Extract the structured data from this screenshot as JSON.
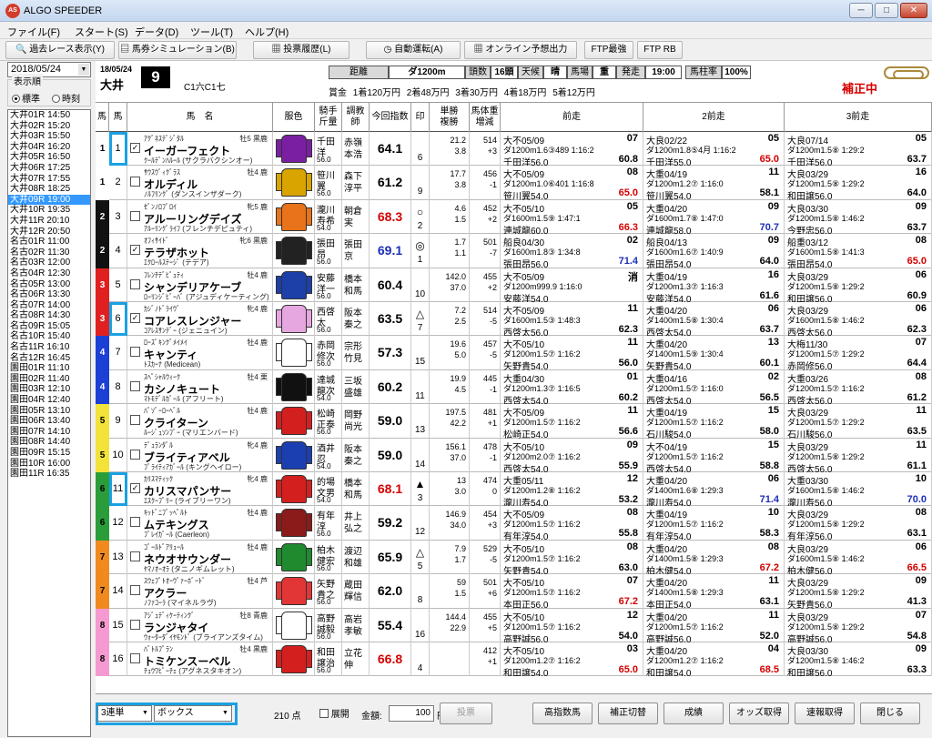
{
  "app": {
    "title": "ALGO SPEEDER",
    "icon_text": "AS"
  },
  "window": {
    "minimize": "─",
    "maximize": "□",
    "close": "✕"
  },
  "menu": [
    "ファイル(F)",
    "スタート(S)",
    "データ(D)",
    "ツール(T)",
    "ヘルプ(H)"
  ],
  "toolbar": [
    {
      "icon": "magnifier-icon",
      "label": "過去レース表示(Y)"
    },
    {
      "icon": "ticket-icon",
      "label": "馬券シミュレーション(B)"
    },
    {
      "icon": "document-icon",
      "label": "投票履歴(L)"
    },
    {
      "icon": "clock-icon",
      "label": "自動運転(A)"
    },
    {
      "icon": "document-icon",
      "label": "オンライン予想出力"
    },
    {
      "icon": "",
      "label": "FTP最強"
    },
    {
      "icon": "",
      "label": "FTP RB"
    }
  ],
  "sidebar": {
    "date": "2018/05/24",
    "display_order_label": "表示順",
    "radio": [
      {
        "label": "標準",
        "selected": true
      },
      {
        "label": "時刻",
        "selected": false
      }
    ],
    "races": [
      "大井01R 14:50",
      "大井02R 15:20",
      "大井03R 15:50",
      "大井04R 16:20",
      "大井05R 16:50",
      "大井06R 17:25",
      "大井07R 17:55",
      "大井08R 18:25",
      "大井09R 19:00",
      "大井10R 19:35",
      "大井11R 20:10",
      "大井12R 20:50",
      "名古01R 11:00",
      "名古02R 11:30",
      "名古03R 12:00",
      "名古04R 12:30",
      "名古05R 13:00",
      "名古06R 13:30",
      "名古07R 14:00",
      "名古08R 14:30",
      "名古09R 15:05",
      "名古10R 15:40",
      "名古11R 16:10",
      "名古12R 16:45",
      "園田01R 11:10",
      "園田02R 11:40",
      "園田03R 12:10",
      "園田04R 12:40",
      "園田05R 13:10",
      "園田06R 13:40",
      "園田07R 14:10",
      "園田08R 14:40",
      "園田09R 15:15",
      "園田10R 16:00",
      "園田11R 16:35"
    ],
    "selected_index": 8
  },
  "race": {
    "date": "18/05/24",
    "track": "大井",
    "race_no": "9",
    "class": "C1六C1七",
    "distance_label": "距離",
    "distance": "ダ1200m",
    "runners_label": "頭数",
    "runners": "16頭",
    "weather_label": "天候",
    "weather": "晴",
    "going_label": "馬場",
    "going": "重",
    "post_label": "発走",
    "post_time": "19:00",
    "pillar_label": "馬柱率",
    "pillar_rate": "100%",
    "prize": "賞金 1着120万円 2着48万円 3着30万円 4着18万円 5着12万円",
    "corrected": "補正中"
  },
  "columns": [
    "馬",
    "馬",
    "馬　名",
    "服色",
    "騎手\n斤量",
    "調教\n師",
    "今回指数",
    "印",
    "単勝\n複勝",
    "馬体重\n増減",
    "前走",
    "2前走",
    "3前走"
  ],
  "horses": [
    {
      "frame": "1",
      "num": "1",
      "checked": true,
      "hl": true,
      "sire": "ｱｸﾞﾈｽﾃﾞｼﾞﾀﾙ",
      "sex": "牡5 黒鹿",
      "name": "イーガーフェクト",
      "dam": "ｸｰﾙﾃﾞﾝﾊﾙｰﾙ (サクラバクシンオー)",
      "silk": "#7a1fa2",
      "j1": "千田",
      "j2": "洋",
      "w": "56.0",
      "t1": "赤嶺",
      "t2": "本浩",
      "idx": "64.1",
      "idxc": "#000",
      "m1": "",
      "m2": "6",
      "o1": "21.2",
      "o2": "3.8",
      "o3": "514",
      "o4": "+3",
      "p1a": "大不05/09",
      "p1b": "ダ1200m1.6③489 1:16:2",
      "p1c": "千田洋56.0",
      "p1pos": "07",
      "p1idx": "60.8",
      "p2a": "大良02/22",
      "p2b": "ダ1200m1.8⑤4月 1:16:2",
      "p2c": "千田洋55.0",
      "p2pos": "05",
      "p2idx": "65.0",
      "p3a": "大良07/14",
      "p3b": "ダ1200m1.5⑧ 1:29:2",
      "p3c": "千田洋56.0",
      "p3pos": "05",
      "p3idx": "63.7"
    },
    {
      "frame": "1",
      "num": "2",
      "checked": false,
      "hl": false,
      "sire": "ｻｳｽｳﾞｨｸﾞﾗｽ",
      "sex": "牡4 鹿",
      "name": "オルディル",
      "dam": "ﾉﾙﾌﾘﾝｸﾞ (ダンスインザダーク)",
      "silk": "#d9a400",
      "j1": "笹川",
      "j2": "翼",
      "w": "56.0",
      "t1": "森下",
      "t2": "淳平",
      "idx": "61.2",
      "idxc": "#000",
      "m1": "",
      "m2": "9",
      "o1": "17.7",
      "o2": "3.8",
      "o3": "456",
      "o4": "-1",
      "p1a": "大不05/09",
      "p1b": "ダ1200m1.0⑥401 1:16:8",
      "p1c": "笹川翼54.0",
      "p1pos": "08",
      "p1idx": "65.0",
      "p2a": "大重04/19",
      "p2b": "ダ1200m1.2⑦ 1:16:0",
      "p2c": "笹川翼54.0",
      "p2pos": "11",
      "p2idx": "58.1",
      "p3a": "大良03/29",
      "p3b": "ダ1200m1.5⑧ 1:29:2",
      "p3c": "和田譲56.0",
      "p3pos": "16",
      "p3idx": "64.0"
    },
    {
      "frame": "2",
      "num": "3",
      "checked": false,
      "hl": false,
      "sire": "ｾﾞﾝﾉﾛﾌﾞﾛｲ",
      "sex": "牝5 鹿",
      "name": "アルーリングデイズ",
      "dam": "ｱﾙｰﾘﾝｸﾞﾗｲﾌ (フレンチデピュティ)",
      "silk": "#e8731a",
      "j1": "瀧川",
      "j2": "寿希",
      "w": "54.0",
      "t1": "朝倉",
      "t2": "実",
      "idx": "68.3",
      "idxc": "#d40000",
      "m1": "○",
      "m2": "2",
      "o1": "4.6",
      "o2": "1.5",
      "o3": "452",
      "o4": "+2",
      "p1a": "大不05/10",
      "p1b": "ダ1600m1.5⑨ 1:47:1",
      "p1c": "連城龍60.0",
      "p1pos": "05",
      "p1idx": "66.3",
      "p2a": "大重04/20",
      "p2b": "ダ1600m1.7⑧ 1:47:0",
      "p2c": "連城龍58.0",
      "p2pos": "09",
      "p2idx": "70.7",
      "p3a": "大良03/30",
      "p3b": "ダ1200m1.5⑧ 1:46:2",
      "p3c": "今野忠56.0",
      "p3pos": "09",
      "p3idx": "63.7"
    },
    {
      "frame": "2",
      "num": "4",
      "checked": true,
      "hl": false,
      "sire": "ｵﾌｨｻｲﾄﾞ",
      "sex": "牝6 黒鹿",
      "name": "テラザホット",
      "dam": "ｴｸﾛｰﾙｽﾃｰｼﾞ (テデア)",
      "silk": "#222",
      "j1": "張田",
      "j2": "昂",
      "w": "56.0",
      "t1": "張田",
      "t2": "京",
      "idx": "69.1",
      "idxc": "#1c2fb8",
      "m1": "◎",
      "m2": "1",
      "o1": "1.7",
      "o2": "1.1",
      "o3": "501",
      "o4": "-7",
      "p1a": "船良04/30",
      "p1b": "ダ1600m1.8③ 1:34:8",
      "p1c": "張田昂56.0",
      "p1pos": "02",
      "p1idx": "71.4",
      "p2a": "船良04/13",
      "p2b": "ダ1600m1.6⑦ 1:40:9",
      "p2c": "張田昂54.0",
      "p2pos": "09",
      "p2idx": "64.0",
      "p3a": "船重03/12",
      "p3b": "ダ1600m1.5⑧ 1:41:3",
      "p3c": "張田昂54.0",
      "p3pos": "08",
      "p3idx": "65.0"
    },
    {
      "frame": "3",
      "num": "5",
      "checked": false,
      "hl": false,
      "sire": "ﾌﾚﾝﾁﾃﾞﾋﾟｭﾃｨ",
      "sex": "牡4 鹿",
      "name": "シャンデリアケーブ",
      "dam": "ﾛｰﾘﾝｼﾞﾋﾞｰﾊﾞ (アジュディケーティング)",
      "silk": "#1c3fa8",
      "j1": "安藤",
      "j2": "洋一",
      "w": "56.0",
      "t1": "橋本",
      "t2": "和馬",
      "idx": "60.4",
      "idxc": "#000",
      "m1": "",
      "m2": "10",
      "o1": "142.0",
      "o2": "37.0",
      "o3": "455",
      "o4": "+2",
      "p1a": "大不05/09",
      "p1b": "ダ1200m999.9 1:16:0",
      "p1c": "安藤洋54.0",
      "p1pos": "消",
      "p1idx": "",
      "p2a": "大重04/19",
      "p2b": "ダ1200m1.3⑦ 1:16:3",
      "p2c": "安藤洋54.0",
      "p2pos": "16",
      "p2idx": "61.6",
      "p3a": "大良03/29",
      "p3b": "ダ1200m1.5⑧ 1:29:2",
      "p3c": "和田譲56.0",
      "p3pos": "06",
      "p3idx": "60.9"
    },
    {
      "frame": "3",
      "num": "6",
      "checked": true,
      "hl": true,
      "sire": "ｶｼﾞﾉﾄﾞﾗｲｳﾞ",
      "sex": "牝4 鹿",
      "name": "コアレスレンジャー",
      "dam": "ｺｱﾚｽｻﾝﾃﾞｰ (ジェニュイン)",
      "silk": "#e6a6e0",
      "j1": "西啓",
      "j2": "太",
      "w": "56.0",
      "t1": "阪本",
      "t2": "秦之",
      "idx": "63.5",
      "idxc": "#000",
      "m1": "△",
      "m2": "7",
      "o1": "7.2",
      "o2": "2.5",
      "o3": "514",
      "o4": "-5",
      "p1a": "大不05/09",
      "p1b": "ダ1600m1.5③ 1:48:3",
      "p1c": "西啓太56.0",
      "p1pos": "11",
      "p1idx": "62.3",
      "p2a": "大重04/20",
      "p2b": "ダ1400m1.5⑧ 1:30:4",
      "p2c": "西啓太54.0",
      "p2pos": "06",
      "p2idx": "63.7",
      "p3a": "大良03/29",
      "p3b": "ダ1600m1.5⑧ 1:46:2",
      "p3c": "西啓太56.0",
      "p3pos": "06",
      "p3idx": "62.3"
    },
    {
      "frame": "4",
      "num": "7",
      "checked": false,
      "hl": false,
      "sire": "ﾛｰｽﾞｷﾝｸﾞﾒｲﾒｲ",
      "sex": "牡4 鹿",
      "name": "キャンティ",
      "dam": "ﾄｽｶｰﾅ (Medicean)",
      "silk": "#fff",
      "j1": "赤岡",
      "j2": "修次",
      "w": "56.0",
      "t1": "宗形",
      "t2": "竹見",
      "idx": "57.3",
      "idxc": "#000",
      "m1": "",
      "m2": "15",
      "o1": "19.6",
      "o2": "5.0",
      "o3": "457",
      "o4": "-5",
      "p1a": "大不05/10",
      "p1b": "ダ1200m1.5⑦ 1:16:2",
      "p1c": "矢野貴54.0",
      "p1pos": "11",
      "p1idx": "56.0",
      "p2a": "大重04/20",
      "p2b": "ダ1400m1.5⑨ 1:30:4",
      "p2c": "矢野貴54.0",
      "p2pos": "13",
      "p2idx": "60.1",
      "p3a": "大梅11/30",
      "p3b": "ダ1200m1.5⑦ 1:29:2",
      "p3c": "赤岡修56.0",
      "p3pos": "07",
      "p3idx": "64.4"
    },
    {
      "frame": "4",
      "num": "8",
      "checked": false,
      "hl": false,
      "sire": "ｽﾍﾟｼｬﾙｳｨｰｸ",
      "sex": "牡4 栗",
      "name": "カシノキュート",
      "dam": "ﾏﾄﾓﾃﾞﾙｶﾞｰﾙ (アフリート)",
      "silk": "#111",
      "j1": "達城",
      "j2": "龍次",
      "w": "54.0",
      "t1": "三坂",
      "t2": "盛雄",
      "idx": "60.2",
      "idxc": "#000",
      "m1": "",
      "m2": "11",
      "o1": "19.9",
      "o2": "4.5",
      "o3": "445",
      "o4": "-1",
      "p1a": "大重04/30",
      "p1b": "ダ1200m1.3⑦ 1:16:5",
      "p1c": "西啓太54.0",
      "p1pos": "01",
      "p1idx": "60.2",
      "p2a": "大重04/16",
      "p2b": "ダ1200m1.5⑦ 1:16:0",
      "p2c": "西啓太54.0",
      "p2pos": "02",
      "p2idx": "56.5",
      "p3a": "大重03/26",
      "p3b": "ダ1200m1.5⑦ 1:16:2",
      "p3c": "西啓太56.0",
      "p3pos": "08",
      "p3idx": "61.2"
    },
    {
      "frame": "5",
      "num": "9",
      "checked": false,
      "hl": false,
      "sire": "ﾊﾟｿﾞｰﾛｰﾍﾞﾙ",
      "sex": "牡4 鹿",
      "name": "クライターン",
      "dam": "ﾙｰｼﾞｭｿﾝﾌﾞｰ (マリエンバード)",
      "silk": "#d41f1f",
      "j1": "松崎",
      "j2": "正泰",
      "w": "56.0",
      "t1": "岡野",
      "t2": "尚光",
      "idx": "59.0",
      "idxc": "#000",
      "m1": "",
      "m2": "13",
      "o1": "197.5",
      "o2": "42.2",
      "o3": "481",
      "o4": "+1",
      "p1a": "大不05/09",
      "p1b": "ダ1200m1.5⑦ 1:16:2",
      "p1c": "松崎正54.0",
      "p1pos": "11",
      "p1idx": "56.6",
      "p2a": "大重04/19",
      "p2b": "ダ1200m1.5⑦ 1:16:2",
      "p2c": "石川駿54.0",
      "p2pos": "15",
      "p2idx": "58.0",
      "p3a": "大良03/29",
      "p3b": "ダ1200m1.5⑦ 1:29:2",
      "p3c": "石川駿56.0",
      "p3pos": "11",
      "p3idx": "63.5"
    },
    {
      "frame": "5",
      "num": "10",
      "checked": false,
      "hl": false,
      "sire": "ﾃﾞｭﾗﾝﾀﾞﾙ",
      "sex": "牝4 鹿",
      "name": "ブライティアベル",
      "dam": "ﾌﾞﾗｲﾃｨｱｶﾞｰﾙ (キングヘイロー)",
      "silk": "#1b3fb0",
      "j1": "酒井",
      "j2": "忍",
      "w": "54.0",
      "t1": "阪本",
      "t2": "秦之",
      "idx": "59.0",
      "idxc": "#000",
      "m1": "",
      "m2": "14",
      "o1": "156.1",
      "o2": "37.0",
      "o3": "478",
      "o4": "-1",
      "p1a": "大不05/10",
      "p1b": "ダ1200m2.0⑦ 1:16:2",
      "p1c": "西啓太54.0",
      "p1pos": "09",
      "p1idx": "55.9",
      "p2a": "大不04/19",
      "p2b": "ダ1200m1.5⑦ 1:16:2",
      "p2c": "西啓太54.0",
      "p2pos": "15",
      "p2idx": "58.8",
      "p3a": "大良03/29",
      "p3b": "ダ1200m1.5⑧ 1:29:2",
      "p3c": "西啓太56.0",
      "p3pos": "11",
      "p3idx": "61.1"
    },
    {
      "frame": "6",
      "num": "11",
      "checked": true,
      "hl": true,
      "sire": "ｶﾘｽﾏﾃｨｯｸ",
      "sex": "牝4 鹿",
      "name": "カリスマパンサー",
      "dam": "ｴｽｸｰﾌﾟﾘｰ (ライブリーワン)",
      "silk": "#d41f1f",
      "j1": "的場",
      "j2": "文男",
      "w": "54.0",
      "t1": "橋本",
      "t2": "和馬",
      "idx": "68.1",
      "idxc": "#d40000",
      "m1": "▲",
      "m2": "3",
      "o1": "13",
      "o2": "3.0",
      "o3": "474",
      "o4": "0",
      "p1a": "大重05/11",
      "p1b": "ダ1200m1.2⑧ 1:16:2",
      "p1c": "瀧川寿54.0",
      "p1pos": "12",
      "p1idx": "53.2",
      "p2a": "大重04/20",
      "p2b": "ダ1400m1.6⑧ 1:29:3",
      "p2c": "瀧川寿54.0",
      "p2pos": "06",
      "p2idx": "71.4",
      "p3a": "大重03/30",
      "p3b": "ダ1600m1.5⑧ 1:46:2",
      "p3c": "瀧川寿56.0",
      "p3pos": "10",
      "p3idx": "70.0"
    },
    {
      "frame": "6",
      "num": "12",
      "checked": false,
      "hl": false,
      "sire": "ｷｯﾄﾞﾆﾌﾞｯﾍﾟﾙﾄ",
      "sex": "牡4 鹿",
      "name": "ムテキングス",
      "dam": "ﾌﾞﾚｲｶﾞｰﾙ (Caerleon)",
      "silk": "#8b1a1a",
      "j1": "有年",
      "j2": "淳",
      "w": "56.0",
      "t1": "井上",
      "t2": "弘之",
      "idx": "59.2",
      "idxc": "#000",
      "m1": "",
      "m2": "12",
      "o1": "146.9",
      "o2": "34.0",
      "o3": "454",
      "o4": "+3",
      "p1a": "大不05/09",
      "p1b": "ダ1200m1.5⑦ 1:16:2",
      "p1c": "有年淳54.0",
      "p1pos": "08",
      "p1idx": "55.8",
      "p2a": "大重04/19",
      "p2b": "ダ1200m1.5⑦ 1:16:2",
      "p2c": "有年淳54.0",
      "p2pos": "10",
      "p2idx": "58.3",
      "p3a": "大良03/29",
      "p3b": "ダ1200m1.5⑧ 1:29:2",
      "p3c": "有年淳56.0",
      "p3pos": "08",
      "p3idx": "63.1"
    },
    {
      "frame": "7",
      "num": "13",
      "checked": false,
      "hl": false,
      "sire": "ｺﾞｰﾙﾄﾞｱﾘｭｰﾙ",
      "sex": "牡4 鹿",
      "name": "ネウオサウンダー",
      "dam": "ﾔﾏﾉｵｰｵﾗ (タニノギムレット)",
      "silk": "#1f8a2e",
      "j1": "柏木",
      "j2": "健宏",
      "w": "56.0",
      "t1": "渡辺",
      "t2": "和雄",
      "idx": "65.9",
      "idxc": "#000",
      "m1": "△",
      "m2": "5",
      "o1": "7.9",
      "o2": "1.7",
      "o3": "529",
      "o4": "-5",
      "p1a": "大不05/10",
      "p1b": "ダ1200m1.5⑦ 1:16:2",
      "p1c": "矢野貴54.0",
      "p1pos": "08",
      "p1idx": "63.0",
      "p2a": "大重04/20",
      "p2b": "ダ1400m1.5⑧ 1:29:3",
      "p2c": "柏木健54.0",
      "p2pos": "08",
      "p2idx": "67.2",
      "p3a": "大良03/29",
      "p3b": "ダ1600m1.5⑧ 1:46:2",
      "p3c": "柏木健56.0",
      "p3pos": "06",
      "p3idx": "66.5"
    },
    {
      "frame": "7",
      "num": "14",
      "checked": false,
      "hl": false,
      "sire": "ｽｳｪﾌﾟﾄｵｰｳﾞｧｰﾎﾞｰﾄﾞ",
      "sex": "牡4 芦",
      "name": "アクラー",
      "dam": "ﾉﾌｧｺｰﾗ (マイネルラヴ)",
      "silk": "#e23636",
      "j1": "矢野",
      "j2": "貴之",
      "w": "56.0",
      "t1": "蔵田",
      "t2": "輝信",
      "idx": "62.0",
      "idxc": "#000",
      "m1": "",
      "m2": "8",
      "o1": "59",
      "o2": "1.5",
      "o3": "501",
      "o4": "+6",
      "p1a": "大不05/10",
      "p1b": "ダ1200m1.5⑦ 1:16:2",
      "p1c": "本田正56.0",
      "p1pos": "07",
      "p1idx": "67.2",
      "p2a": "大重04/20",
      "p2b": "ダ1400m1.5⑧ 1:29:3",
      "p2c": "本田正54.0",
      "p2pos": "11",
      "p2idx": "63.1",
      "p3a": "大良03/29",
      "p3b": "ダ1200m1.5⑧ 1:29:2",
      "p3c": "矢野貴56.0",
      "p3pos": "09",
      "p3idx": "41.3"
    },
    {
      "frame": "8",
      "num": "15",
      "checked": false,
      "hl": false,
      "sire": "ｱｼﾞｭﾃﾞｨｹｰﾃｨﾝｸﾞ",
      "sex": "牡8 青鹿",
      "name": "ランジャタイ",
      "dam": "ｳｫｰﾀｰﾀﾞｲﾔﾓﾝﾄﾞ (ブライアンズタイム)",
      "silk": "#fff",
      "j1": "高野",
      "j2": "誠毅",
      "w": "56.0",
      "t1": "高岩",
      "t2": "孝敏",
      "idx": "55.4",
      "idxc": "#000",
      "m1": "",
      "m2": "16",
      "o1": "144.4",
      "o2": "22.9",
      "o3": "455",
      "o4": "+5",
      "p1a": "大不05/10",
      "p1b": "ダ1200m1.5⑦ 1:16:2",
      "p1c": "高野誠56.0",
      "p1pos": "12",
      "p1idx": "54.0",
      "p2a": "大重04/20",
      "p2b": "ダ1200m1.5⑦ 1:16:2",
      "p2c": "高野誠56.0",
      "p2pos": "11",
      "p2idx": "52.0",
      "p3a": "大良03/29",
      "p3b": "ダ1200m1.5⑧ 1:29:2",
      "p3c": "高野誠56.0",
      "p3pos": "07",
      "p3idx": "54.8"
    },
    {
      "frame": "8",
      "num": "16",
      "checked": false,
      "hl": false,
      "sire": "ﾊﾞﾄﾙﾌﾟﾗﾝ",
      "sex": "牡4 黒鹿",
      "name": "トミケンスーベル",
      "dam": "ﾁｭｳﾜﾋﾟｰﾁｪ (アグネスタキオン)",
      "silk": "#d41f1f",
      "j1": "和田",
      "j2": "譲治",
      "w": "56.0",
      "t1": "立花",
      "t2": "伸",
      "idx": "66.8",
      "idxc": "#d40000",
      "m1": "",
      "m2": "4",
      "o1": "",
      "o2": "",
      "o3": "412",
      "o4": "+1",
      "p1a": "大不05/10",
      "p1b": "ダ1200m1.2⑦ 1:16:2",
      "p1c": "和田譲54.0",
      "p1pos": "03",
      "p1idx": "65.0",
      "p2a": "大重04/20",
      "p2b": "ダ1200m1.2⑦ 1:16:2",
      "p2c": "和田譲54.0",
      "p2pos": "04",
      "p2idx": "68.5",
      "p3a": "大良03/30",
      "p3b": "ダ1200m1.5⑧ 1:46:2",
      "p3c": "和田譲56.0",
      "p3pos": "09",
      "p3idx": "63.3"
    }
  ],
  "frame_colors": {
    "1": "#ffffff",
    "2": "#111111",
    "3": "#e02020",
    "4": "#1c3fd6",
    "5": "#f3e23a",
    "6": "#2a9c3a",
    "7": "#f08a1e",
    "8": "#f59ad0"
  },
  "bottom": {
    "bet_type": "3連単",
    "bet_method": "ボックス",
    "points": "210",
    "points_unit": "点",
    "expand_label": "展開",
    "amount_label": "金額:",
    "amount": "100",
    "yen": "円",
    "buttons": [
      "投票",
      "高指数馬",
      "補正切替",
      "成績",
      "オッズ取得",
      "速報取得",
      "閉じる"
    ]
  }
}
